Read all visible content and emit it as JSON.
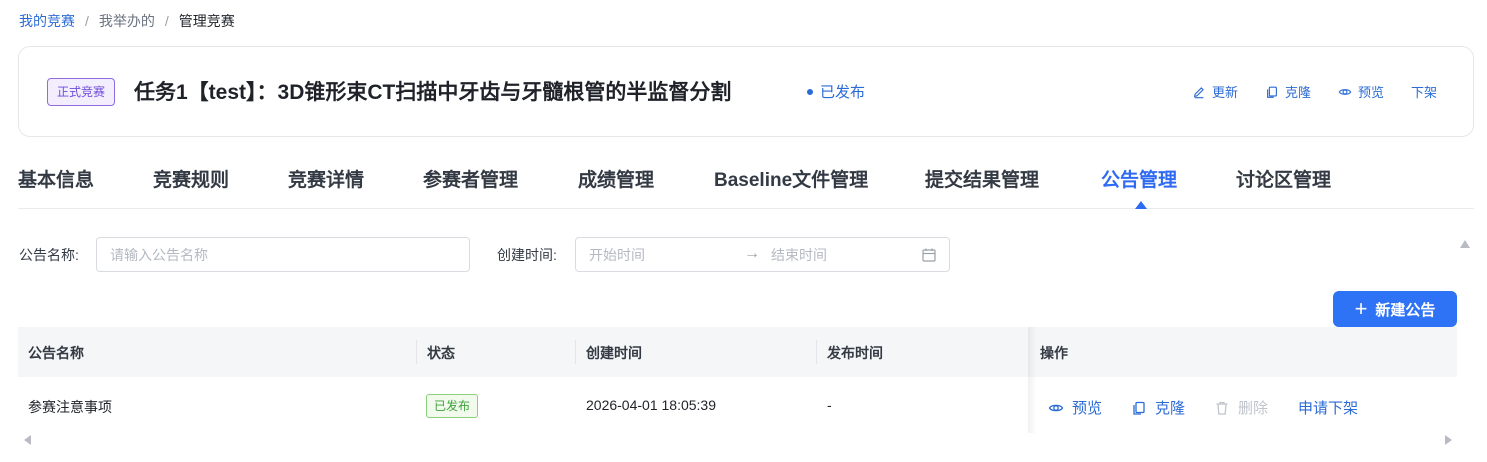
{
  "breadcrumb": {
    "items": [
      "我的竞赛",
      "我举办的",
      "管理竞赛"
    ],
    "separator": "/"
  },
  "competition": {
    "type_tag": "正式竞赛",
    "title": "任务1【test】：3D锥形束CT扫描中牙齿与牙髓根管的半监督分割",
    "status": "已发布"
  },
  "header_actions": {
    "update": "更新",
    "clone": "克隆",
    "preview": "预览",
    "unpublish": "下架"
  },
  "tabs": [
    {
      "label": "基本信息"
    },
    {
      "label": "竞赛规则"
    },
    {
      "label": "竞赛详情"
    },
    {
      "label": "参赛者管理"
    },
    {
      "label": "成绩管理"
    },
    {
      "label": "Baseline文件管理"
    },
    {
      "label": "提交结果管理"
    },
    {
      "label": "公告管理",
      "active": true
    },
    {
      "label": "讨论区管理"
    }
  ],
  "filters": {
    "name_label": "公告名称:",
    "name_placeholder": "请输入公告名称",
    "time_label": "创建时间:",
    "start_placeholder": "开始时间",
    "end_placeholder": "结束时间",
    "range_arrow": "→"
  },
  "new_button": {
    "plus": "+",
    "label": "新建公告"
  },
  "table": {
    "columns": [
      "公告名称",
      "状态",
      "创建时间",
      "发布时间",
      "操作"
    ],
    "rows": [
      {
        "name": "参赛注意事项",
        "status": "已发布",
        "created": "2026-04-01 18:05:39",
        "published": "-",
        "ops": {
          "preview": "预览",
          "clone": "克隆",
          "delete": "删除",
          "request_unpublish": "申请下架"
        }
      }
    ]
  },
  "colors": {
    "primary": "#2e72f5",
    "link": "#2b6bd6",
    "tag_purple": "#6f4bd8",
    "success_green": "#3fa33a",
    "disabled": "#c0c4cc"
  },
  "icons": [
    "edit-icon",
    "copy-icon",
    "eye-icon",
    "calendar-icon",
    "trash-icon",
    "plus-icon"
  ]
}
